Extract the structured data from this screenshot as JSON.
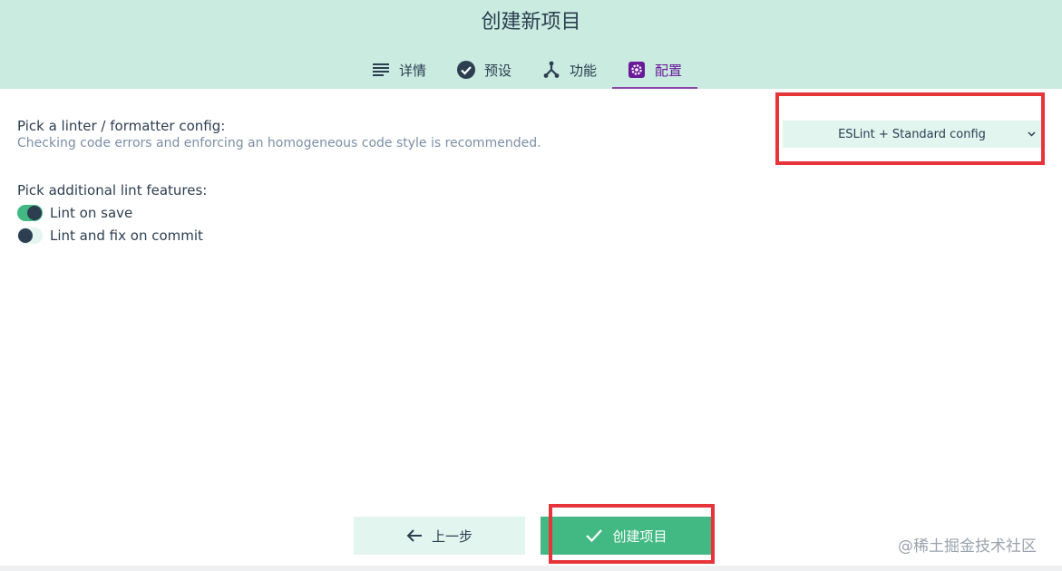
{
  "header": {
    "title": "创建新项目",
    "tabs": [
      {
        "label": "详情",
        "icon": "list-icon",
        "active": false
      },
      {
        "label": "预设",
        "icon": "check-circle-icon",
        "active": false
      },
      {
        "label": "功能",
        "icon": "fork-icon",
        "active": false
      },
      {
        "label": "配置",
        "icon": "settings-icon",
        "active": true
      }
    ]
  },
  "linter": {
    "title": "Pick a linter / formatter config:",
    "description": "Checking code errors and enforcing an homogeneous code style is recommended.",
    "selected": "ESLint + Standard config"
  },
  "features": {
    "title": "Pick additional lint features:",
    "items": [
      {
        "label": "Lint on save",
        "enabled": true
      },
      {
        "label": "Lint and fix on commit",
        "enabled": false
      }
    ]
  },
  "buttons": {
    "back": "上一步",
    "create": "创建项目"
  },
  "watermark": "@稀土掘金技术社区",
  "colors": {
    "header_bg": "#c9ebe0",
    "accent_green": "#42b983",
    "active_tab": "#6a1b9a",
    "annotation_red": "#e7343b",
    "text_dark": "#2c3e50"
  }
}
